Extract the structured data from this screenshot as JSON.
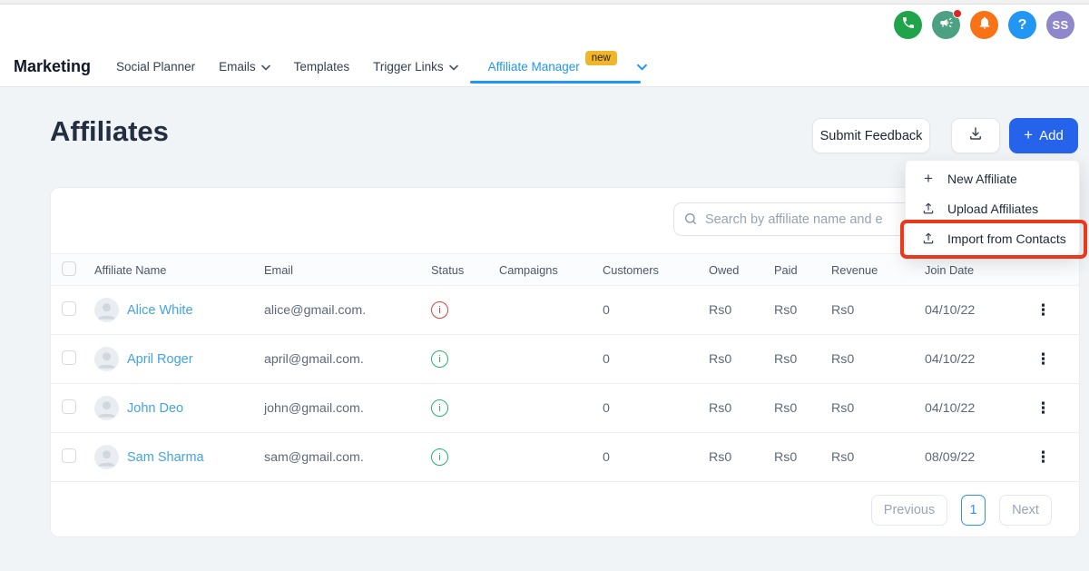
{
  "topbar": {
    "avatar_initials": "SS",
    "help_glyph": "?",
    "icon_colors": {
      "phone": "#1fa44c",
      "announcement": "#4ba181",
      "notifications": "#f97316",
      "help": "#2196f3",
      "avatar": "#8f87cb"
    }
  },
  "nav": {
    "brand": "Marketing",
    "items": {
      "social_planner": "Social Planner",
      "emails": "Emails",
      "templates": "Templates",
      "trigger_links": "Trigger Links",
      "affiliate_manager": "Affiliate Manager"
    },
    "badge": "new",
    "active_tab": "Affiliate Manager",
    "active_color": "#2196f3"
  },
  "page": {
    "title": "Affiliates"
  },
  "actions": {
    "submit_feedback": "Submit Feedback",
    "add": "Add"
  },
  "add_menu": {
    "items": {
      "new_affiliate": "New Affiliate",
      "upload_affiliates": "Upload Affiliates",
      "import_from_contacts": "Import from Contacts"
    },
    "highlighted_item": "Import from Contacts",
    "highlight_color": "#e8391d"
  },
  "search": {
    "placeholder": "Search by affiliate name and e"
  },
  "table": {
    "columns": {
      "name": "Affiliate Name",
      "email": "Email",
      "status": "Status",
      "campaigns": "Campaigns",
      "customers": "Customers",
      "owed": "Owed",
      "paid": "Paid",
      "revenue": "Revenue",
      "join_date": "Join Date"
    },
    "rows": [
      {
        "name": "Alice White",
        "email": "alice@gmail.com.",
        "status": "inactive",
        "campaigns": "",
        "customers": "0",
        "owed": "Rs0",
        "paid": "Rs0",
        "revenue": "Rs0",
        "join_date": "04/10/22"
      },
      {
        "name": "April Roger",
        "email": "april@gmail.com.",
        "status": "active",
        "campaigns": "",
        "customers": "0",
        "owed": "Rs0",
        "paid": "Rs0",
        "revenue": "Rs0",
        "join_date": "04/10/22"
      },
      {
        "name": "John Deo",
        "email": "john@gmail.com.",
        "status": "active",
        "campaigns": "",
        "customers": "0",
        "owed": "Rs0",
        "paid": "Rs0",
        "revenue": "Rs0",
        "join_date": "04/10/22"
      },
      {
        "name": "Sam Sharma",
        "email": "sam@gmail.com.",
        "status": "active",
        "campaigns": "",
        "customers": "0",
        "owed": "Rs0",
        "paid": "Rs0",
        "revenue": "Rs0",
        "join_date": "08/09/22"
      }
    ],
    "status_colors": {
      "active": "#26b56b",
      "inactive": "#d9403f"
    }
  },
  "pagination": {
    "previous": "Previous",
    "page": "1",
    "next": "Next"
  },
  "icons": {
    "plus": "+",
    "kebab": "⋮",
    "status_info": "i"
  },
  "colors": {
    "primary_button": "#2563eb",
    "link_blue": "#44a3e0",
    "badge_yellow": "#f1b52c"
  }
}
